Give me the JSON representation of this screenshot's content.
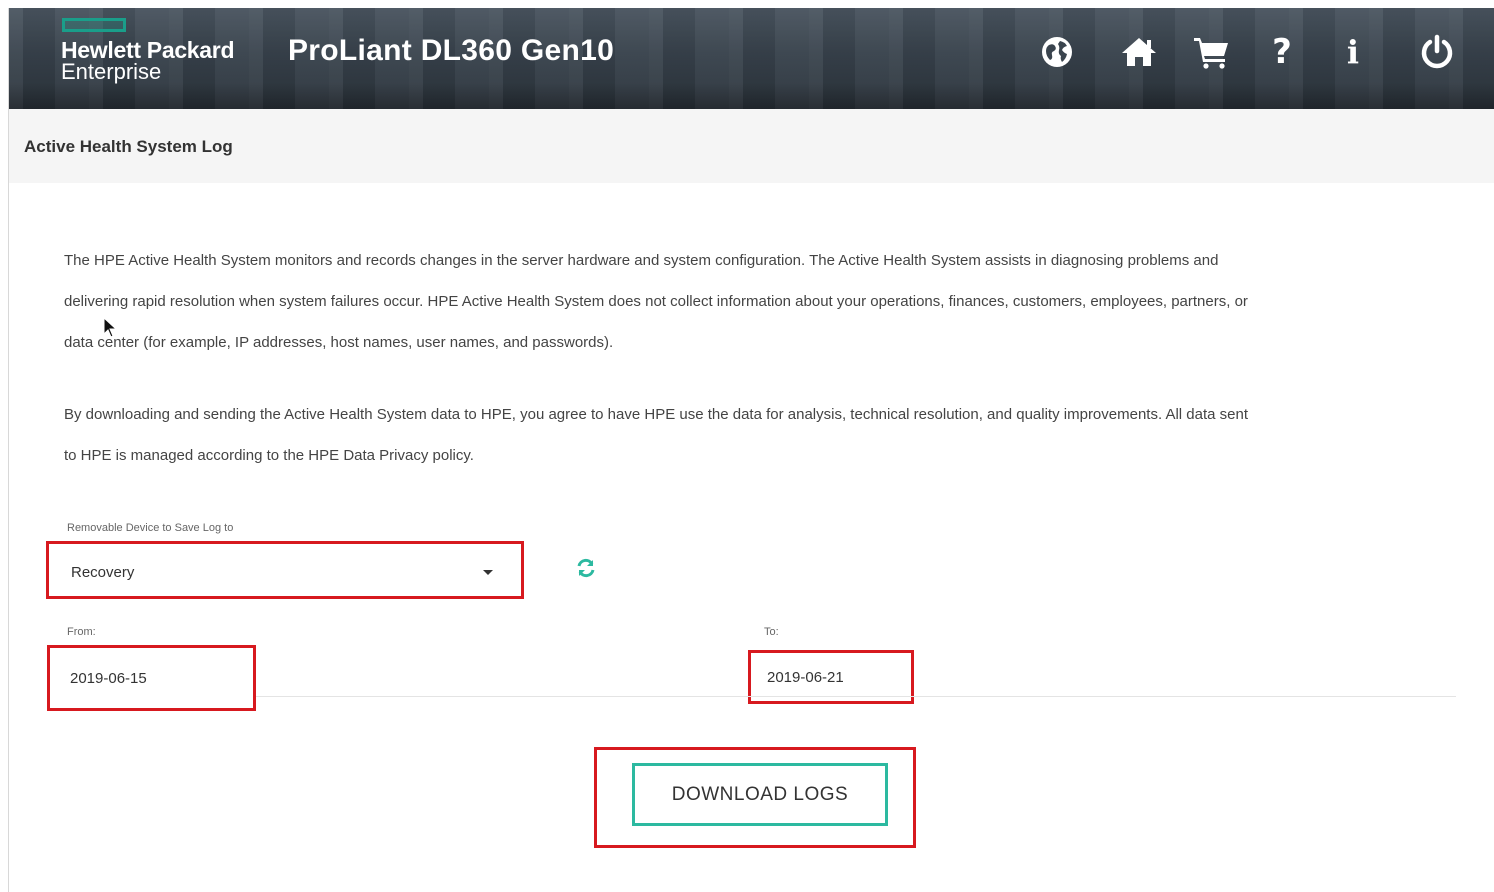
{
  "header": {
    "brand_line1": "Hewlett Packard",
    "brand_line2": "Enterprise",
    "product_title": "ProLiant DL360 Gen10",
    "icons": [
      "globe-icon",
      "home-icon",
      "cart-icon",
      "help-icon",
      "info-icon",
      "power-icon"
    ]
  },
  "page": {
    "title": "Active Health System Log"
  },
  "content": {
    "paragraph1": "The HPE Active Health System monitors and records changes in the server hardware and system configuration. The Active Health System assists in diagnosing problems and delivering rapid resolution when system failures occur. HPE Active Health System does not collect information about your operations, finances, customers, employees, partners, or data center (for example, IP addresses, host names, user names, and passwords).",
    "paragraph2": "By downloading and sending the Active Health System data to HPE, you agree to have HPE use the data for analysis, technical resolution, and quality improvements. All data sent to HPE is managed according to the HPE Data Privacy policy."
  },
  "form": {
    "device_label": "Removable Device to Save Log to",
    "device_value": "Recovery",
    "from_label": "From:",
    "from_value": "2019-06-15",
    "to_label": "To:",
    "to_value": "2019-06-21",
    "download_label": "DOWNLOAD LOGS"
  },
  "colors": {
    "highlight_border": "#d7191f",
    "accent_teal": "#2cb9a0",
    "header_bg": "#38424c"
  }
}
